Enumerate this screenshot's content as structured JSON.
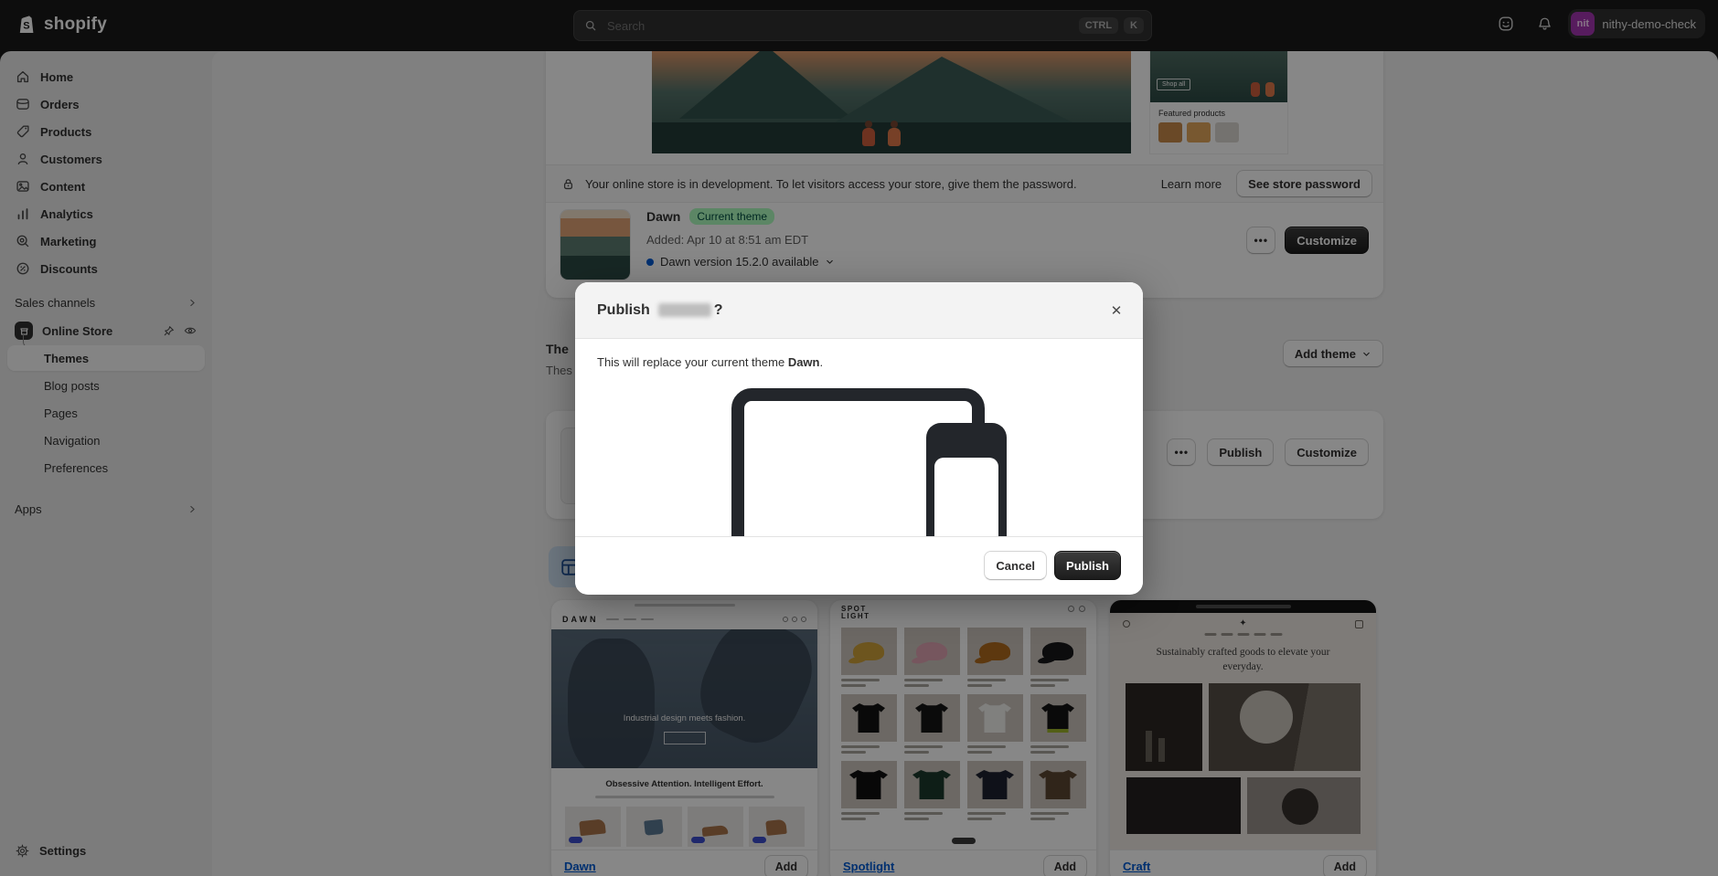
{
  "topbar": {
    "brand": "shopify",
    "search_placeholder": "Search",
    "shortcut_ctrl": "CTRL",
    "shortcut_k": "K",
    "store_name": "nithy-demo-check",
    "avatar_initials": "nit"
  },
  "sidebar": {
    "items": [
      "Home",
      "Orders",
      "Products",
      "Customers",
      "Content",
      "Analytics",
      "Marketing",
      "Discounts"
    ],
    "sales_channels_label": "Sales channels",
    "online_store_label": "Online Store",
    "online_store_subitems": [
      "Themes",
      "Blog posts",
      "Pages",
      "Navigation",
      "Preferences"
    ],
    "apps_label": "Apps",
    "settings_label": "Settings"
  },
  "banner": {
    "message": "Your online store is in development. To let visitors access your store, give them the password.",
    "learn_more_label": "Learn more",
    "password_button_label": "See store password"
  },
  "current_theme": {
    "name": "Dawn",
    "badge": "Current theme",
    "added": "Added: Apr 10 at 8:51 am EDT",
    "version_notice": "Dawn version 15.2.0 available",
    "customize_label": "Customize"
  },
  "library": {
    "heading_fragment": "The",
    "subtext_fragment": "Thes",
    "add_theme_label": "Add theme",
    "row_publish_label": "Publish",
    "row_customize_label": "Customize"
  },
  "top_previews": {
    "shop_all_label": "Shop all",
    "featured_label": "Featured products"
  },
  "theme_cards": [
    {
      "name": "Dawn",
      "add_label": "Add",
      "logo": "DAWN",
      "hero_text": "Industrial design meets fashion.",
      "tagline": "Obsessive Attention. Intelligent Effort."
    },
    {
      "name": "Spotlight",
      "add_label": "Add",
      "logo_line1": "SPOT",
      "logo_line2": "LIGHT"
    },
    {
      "name": "Craft",
      "add_label": "Add",
      "heading": "Sustainably crafted goods to elevate your everyday."
    }
  ],
  "modal": {
    "title_prefix": "Publish",
    "title_suffix": "?",
    "body_prefix": "This will replace your current theme ",
    "body_theme": "Dawn",
    "body_suffix": ".",
    "cancel_label": "Cancel",
    "publish_label": "Publish"
  },
  "icons": {
    "more": "•••",
    "close": "✕"
  },
  "colors": {
    "badge_bg": "#affebf",
    "badge_text": "#014b40",
    "avatar": "#a435b2",
    "link": "#005bd3",
    "primary_button": "#1f1f1f",
    "version_dot": "#005bd3",
    "topbar": "#1a1a1a",
    "sidebar_bg": "#ebebeb",
    "content_bg": "#f1f1f1"
  }
}
